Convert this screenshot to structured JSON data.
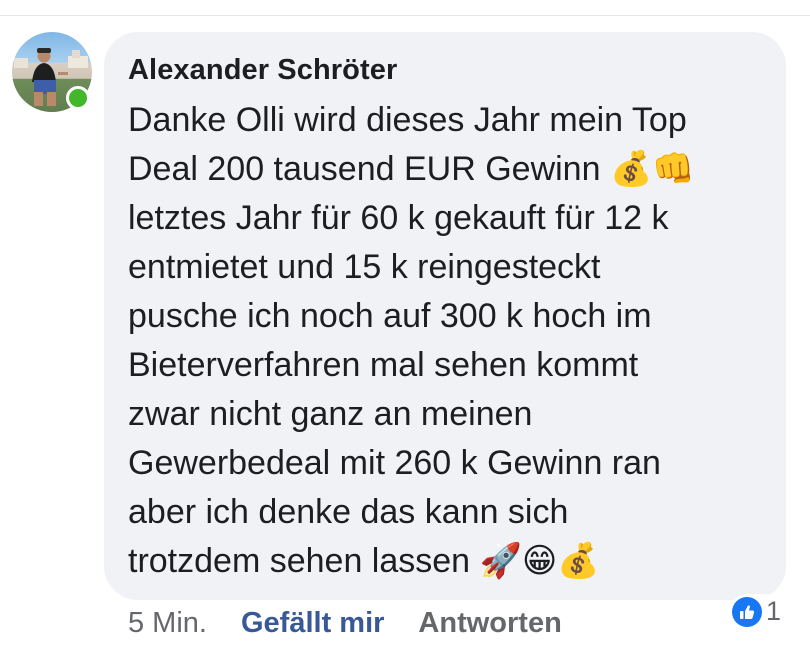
{
  "comment": {
    "author": "Alexander Schröter",
    "text": "Danke Olli wird dieses Jahr mein Top\nDeal 200 tausend EUR Gewinn 💰👊\nletztes Jahr für 60 k gekauft für 12 k\nentmietet und 15 k reingesteckt\npusche ich noch auf 300 k hoch im\nBieterverfahren mal sehen kommt\nzwar nicht ganz an meinen\nGewerbedeal mit 260 k Gewinn ran\naber ich denke das kann sich\ntrotzdem sehen lassen 🚀😁💰",
    "time": "5 Min.",
    "like_label": "Gefällt mir",
    "reply_label": "Antworten",
    "reaction_count": "1",
    "reaction_icon": "thumbs-up-icon",
    "online": true
  },
  "colors": {
    "bubble": "#f0f2f5",
    "text": "#1c1e21",
    "link": "#385898",
    "muted": "#65676b",
    "online": "#42b72a",
    "like": "#1877f2"
  }
}
